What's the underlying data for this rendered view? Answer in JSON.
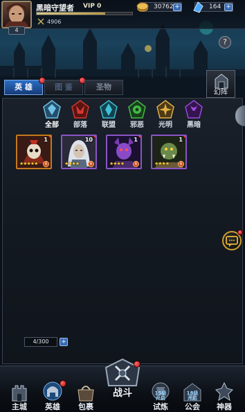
{
  "header": {
    "player_name": "黑暗守望者",
    "vip": "VIP 0",
    "level": "4",
    "power": "4906",
    "exp_fraction": 0.72,
    "gold": "30762",
    "gems": "164",
    "help_label": "?"
  },
  "tabs": [
    {
      "label": "英 雄",
      "active": true
    },
    {
      "label": "图 鉴",
      "active": false
    },
    {
      "label": "圣物",
      "active": false
    }
  ],
  "mirror_label": "幻阵",
  "filters": [
    {
      "label": "全部",
      "icon": "all-faction-icon",
      "color": "#6fc2e6"
    },
    {
      "label": "部落",
      "icon": "horde-faction-icon",
      "color": "#d23a30"
    },
    {
      "label": "联盟",
      "icon": "alliance-faction-icon",
      "color": "#3ec0d6"
    },
    {
      "label": "邪恶",
      "icon": "evil-faction-icon",
      "color": "#48b84a"
    },
    {
      "label": "光明",
      "icon": "light-faction-icon",
      "color": "#e0b048"
    },
    {
      "label": "黑暗",
      "icon": "dark-faction-icon",
      "color": "#9a4ad8"
    }
  ],
  "heroes": [
    {
      "count": "1",
      "stars": 5,
      "frame": "orange",
      "portrait": "skull-mask-hero-portrait"
    },
    {
      "count": "10",
      "stars": 4,
      "frame": "purple",
      "portrait": "white-hair-hero-portrait"
    },
    {
      "count": "1",
      "stars": 4,
      "frame": "purple",
      "portrait": "purple-demon-hero-portrait"
    },
    {
      "count": "1",
      "stars": 4,
      "frame": "purple",
      "portrait": "orc-warrior-hero-portrait"
    }
  ],
  "capacity": "4/300",
  "nav": [
    {
      "label": "主城",
      "icon": "castle-icon",
      "extra": ""
    },
    {
      "label": "英雄",
      "icon": "hero-helmet-icon",
      "extra": ""
    },
    {
      "label": "包裹",
      "icon": "bag-icon",
      "extra": ""
    },
    {
      "label": "战斗",
      "icon": "battle-emblem-icon",
      "extra": ""
    },
    {
      "label": "试炼",
      "icon": "trial-icon",
      "extra": "15级\n开启"
    },
    {
      "label": "公会",
      "icon": "guild-icon",
      "extra": "18级\n开启"
    },
    {
      "label": "神器",
      "icon": "artifact-icon",
      "extra": ""
    }
  ]
}
